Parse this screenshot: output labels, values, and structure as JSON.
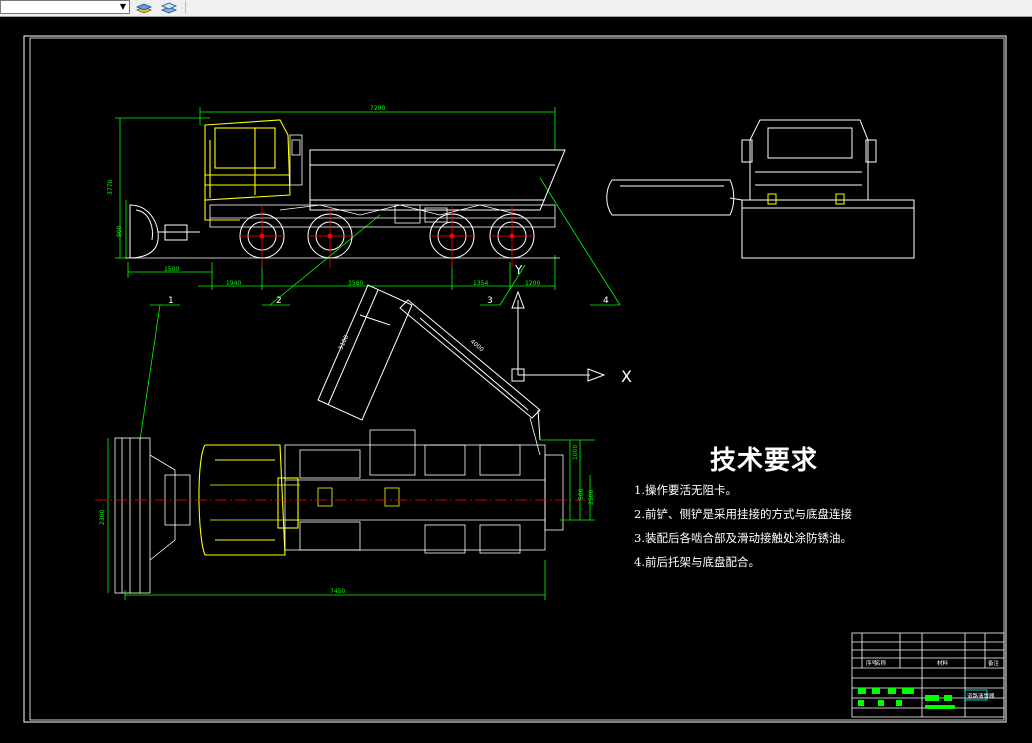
{
  "toolbar": {
    "layer_combo_value": "",
    "icons": [
      "layer-states-icon",
      "layer-previous-icon"
    ]
  },
  "drawing": {
    "dimensions": {
      "overall_length": "7290",
      "height": "3770",
      "blade_height": "900",
      "front_overhang": "1500",
      "axle1": "1940",
      "wheelbase": "3580",
      "axle_gap": "1354",
      "rear_overhang": "1200",
      "arm_upper": "5100",
      "arm_lower": "4000",
      "plan_length": "7450",
      "plan_width": "2300",
      "right_dim1": "1000",
      "right_dim2": "2500",
      "right_dim3": "500"
    },
    "callouts": [
      "1",
      "2",
      "3",
      "4"
    ],
    "axis_x": "X",
    "axis_y": "Y"
  },
  "tech_requirements": {
    "title": "技术要求",
    "items": [
      "1.操作要活无阻卡。",
      "2.前铲、侧铲是采用挂接的方式与底盘连接",
      "3.装配后各啮合部及滑动接触处涂防锈油。",
      "4.前后托架与底盘配合。"
    ]
  },
  "title_block": {
    "headers": [
      "序号",
      "名称",
      "材料",
      "备注"
    ],
    "drawing_name": "道路清雪器"
  },
  "colors": {
    "background": "#000000",
    "outline": "#ffffff",
    "dimension": "#00ff00",
    "detail": "#ffff00",
    "centerline": "#ff0000",
    "toolbar": "#f0f0f0"
  }
}
